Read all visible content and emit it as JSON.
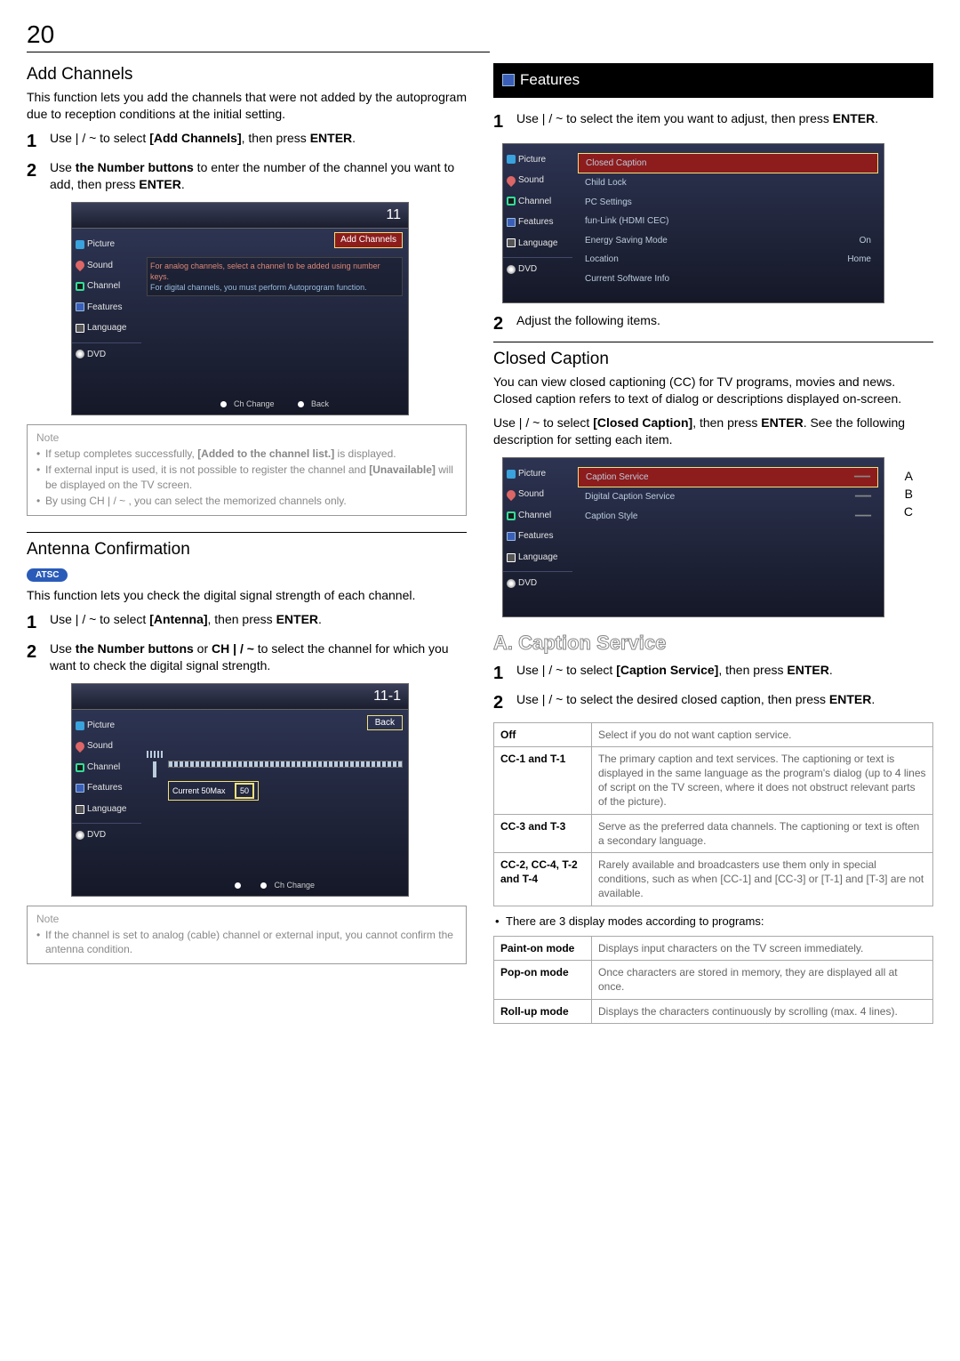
{
  "page_number": "20",
  "left": {
    "addch_title": "Add Channels",
    "addch_intro": "This function lets you add the channels that were not added by the autoprogram due to reception conditions at the initial setting.",
    "step1_a": "Use  |  / ~ to select ",
    "step1_b": "[Add Channels]",
    "step1_c": ", then press ",
    "step1_d": "ENTER",
    "step1_e": ".",
    "step2_a": "Use ",
    "step2_b": "the Number buttons",
    "step2_c": " to enter the number of the channel you want to add, then press ",
    "step2_d": "ENTER",
    "step2_e": ".",
    "osd1_display": "11",
    "osd1_hl": "Add Channels",
    "osd1_help1": "For analog channels, select a channel to be added using number keys.",
    "osd1_help2": "For digital channels, you must perform Autoprogram function.",
    "osd1_foot1": "Ch Change",
    "osd1_foot2": "Back",
    "note1_head": "Note",
    "note1_i1a": "If setup completes successfully, ",
    "note1_i1b": "[Added to the channel list.]",
    "note1_i1c": " is displayed.",
    "note1_i2a": "If external input is used, it is not possible to register the channel and ",
    "note1_i2b": "[Unavailable]",
    "note1_i2c": " will be displayed on the TV screen.",
    "note1_i3": "By using CH  |  / ~ , you can select the memorized channels only.",
    "ant_title": "Antenna Confirmation",
    "atsc": "ATSC",
    "ant_intro": "This function lets you check the digital signal strength of each channel.",
    "ant_s1_a": "Use  |  / ~ to select ",
    "ant_s1_b": "[Antenna]",
    "ant_s1_c": ", then press ",
    "ant_s1_d": "ENTER",
    "ant_s1_e": ".",
    "ant_s2_a": "Use ",
    "ant_s2_b": "the Number buttons",
    "ant_s2_c": " or ",
    "ant_s2_d": "CH  |  / ~",
    "ant_s2_e": " to select the channel for which you want to check the digital signal strength.",
    "osd2_display": "11-1",
    "osd2_back": "Back",
    "osd2_cur": "Current  50Max",
    "osd2_val": "50",
    "osd2_foot": "Ch Change",
    "note2_head": "Note",
    "note2_i1": "If the channel is set to analog (cable) channel or external input, you cannot confirm the antenna condition.",
    "side_picture": "Picture",
    "side_sound": "Sound",
    "side_channel": "Channel",
    "side_features": "Features",
    "side_language": "Language",
    "side_dvd": "DVD"
  },
  "right": {
    "features_bar": "Features",
    "step1_a": "Use  |  / ~ to select the item you want to adjust, then press ",
    "step1_b": "ENTER",
    "step1_c": ".",
    "feat_items": [
      {
        "label": "Closed Caption",
        "val": "",
        "hl": true
      },
      {
        "label": "Child Lock",
        "val": ""
      },
      {
        "label": "PC Settings",
        "val": ""
      },
      {
        "label": "fun-Link (HDMI CEC)",
        "val": ""
      },
      {
        "label": "Energy Saving Mode",
        "val": "On"
      },
      {
        "label": "Location",
        "val": "Home"
      },
      {
        "label": "Current Software Info",
        "val": ""
      }
    ],
    "step2": "Adjust the following items.",
    "cc_title": "Closed Caption",
    "cc_intro": "You can view closed captioning (CC) for TV programs, movies and news. Closed caption refers to text of dialog or descriptions displayed on-screen.",
    "cc_use_a": "Use  |  / ~ to select ",
    "cc_use_b": "[Closed Caption]",
    "cc_use_c": ", then press ",
    "cc_use_d": "ENTER",
    "cc_use_e": ". See the following description for setting each item.",
    "cc_items": [
      {
        "label": "Caption Service",
        "tag": "A"
      },
      {
        "label": "Digital Caption Service",
        "tag": "B"
      },
      {
        "label": "Caption Style",
        "tag": "C"
      }
    ],
    "caption_service_heading": "A. Caption Service",
    "cs_s1_a": "Use  |  / ~ to select ",
    "cs_s1_b": "[Caption Service]",
    "cs_s1_c": ", then press ",
    "cs_s1_d": "ENTER",
    "cs_s1_e": ".",
    "cs_s2_a": "Use  |  / ~ to select the desired closed caption, then press ",
    "cs_s2_b": "ENTER",
    "cs_s2_c": ".",
    "tbl1": [
      {
        "k": "Off",
        "v": "Select if you do not want caption service."
      },
      {
        "k": "CC-1 and T-1",
        "v": "The primary caption and text services. The captioning or text is displayed in the same language as the program's dialog (up to 4 lines of script on the TV screen, where it does not obstruct relevant parts of the picture)."
      },
      {
        "k": "CC-3 and T-3",
        "v": "Serve as the preferred data channels. The captioning or text is often a secondary language."
      },
      {
        "k": "CC-2, CC-4, T-2 and T-4",
        "v": "Rarely available and broadcasters use them only in special conditions, such as when [CC-1] and [CC-3] or [T-1] and [T-3] are not available."
      }
    ],
    "modes_intro": "There are 3 display modes according to programs:",
    "tbl2": [
      {
        "k": "Paint-on mode",
        "v": "Displays input characters on the TV screen immediately."
      },
      {
        "k": "Pop-on mode",
        "v": "Once characters are stored in memory, they are displayed all at once."
      },
      {
        "k": "Roll-up mode",
        "v": "Displays the characters continuously by scrolling (max. 4 lines)."
      }
    ]
  }
}
